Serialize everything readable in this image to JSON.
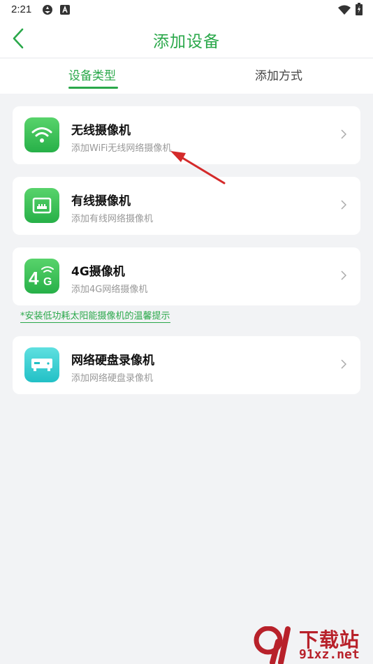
{
  "status_bar": {
    "time": "2:21"
  },
  "header": {
    "title": "添加设备",
    "back_icon": "chevron-left-icon"
  },
  "tabs": [
    {
      "label": "设备类型",
      "active": true
    },
    {
      "label": "添加方式",
      "active": false
    }
  ],
  "devices": [
    {
      "title": "无线摄像机",
      "subtitle": "添加WiFi无线网络摄像机",
      "icon": "wifi-icon"
    },
    {
      "title": "有线摄像机",
      "subtitle": "添加有线网络摄像机",
      "icon": "ethernet-port-icon"
    },
    {
      "title": "4G摄像机",
      "subtitle": "添加4G网络摄像机",
      "icon": "4g-signal-icon"
    },
    {
      "title": "网络硬盘录像机",
      "subtitle": "添加网络硬盘录像机",
      "icon": "nvr-box-icon"
    }
  ],
  "tip": "*安装低功耗太阳能摄像机的温馨提示",
  "watermark": {
    "text": "下载站",
    "url": "91xz.net"
  },
  "colors": {
    "accent": "#2aa84a",
    "arrow": "#d42a2a",
    "teal": "#22c0c6",
    "watermark": "#b8212a"
  }
}
